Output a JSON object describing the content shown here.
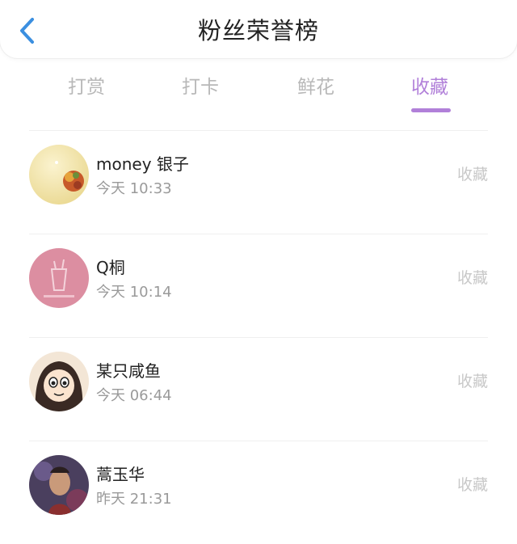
{
  "header": {
    "back_icon": "chevron-left-icon",
    "title": "粉丝荣誉榜"
  },
  "tabs": [
    {
      "label": "打赏",
      "active": false
    },
    {
      "label": "打卡",
      "active": false
    },
    {
      "label": "鲜花",
      "active": false
    },
    {
      "label": "收藏",
      "active": true
    }
  ],
  "colors": {
    "accent": "#b180d9",
    "back_icon": "#3b8fe0",
    "inactive_tab": "#b8b8b8"
  },
  "fans": [
    {
      "name": "money 银子",
      "time": "今天 10:33",
      "action": "收藏"
    },
    {
      "name": "Q桐",
      "time": "今天 10:14",
      "action": "收藏"
    },
    {
      "name": "某只咸鱼",
      "time": "今天 06:44",
      "action": "收藏"
    },
    {
      "name": "蒿玉华",
      "time": "昨天 21:31",
      "action": "收藏"
    }
  ]
}
